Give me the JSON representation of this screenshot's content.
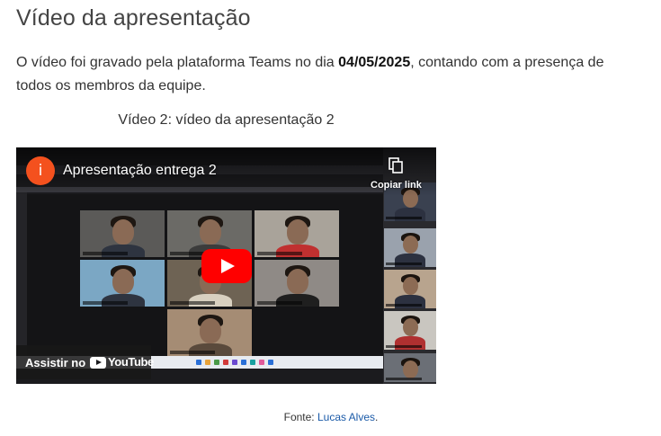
{
  "heading": "Vídeo da apresentação",
  "paragraph": {
    "before": "O vídeo foi gravado pela plataforma Teams no dia ",
    "date": "04/05/2025",
    "after": ", contando com a presença de todos os membros da equipe."
  },
  "caption": "Vídeo 2: vídeo da apresentação 2",
  "video": {
    "title": "Apresentação entrega 2",
    "channel_initial": "i",
    "copy_link_label": "Copiar link",
    "watch_on_label": "Assistir no",
    "youtube_label": "YouTube",
    "channel_color": "#f4511e",
    "play_color": "#ff0000"
  },
  "source": {
    "prefix": "Fonte: ",
    "author": "Lucas Alves",
    "suffix": "."
  }
}
